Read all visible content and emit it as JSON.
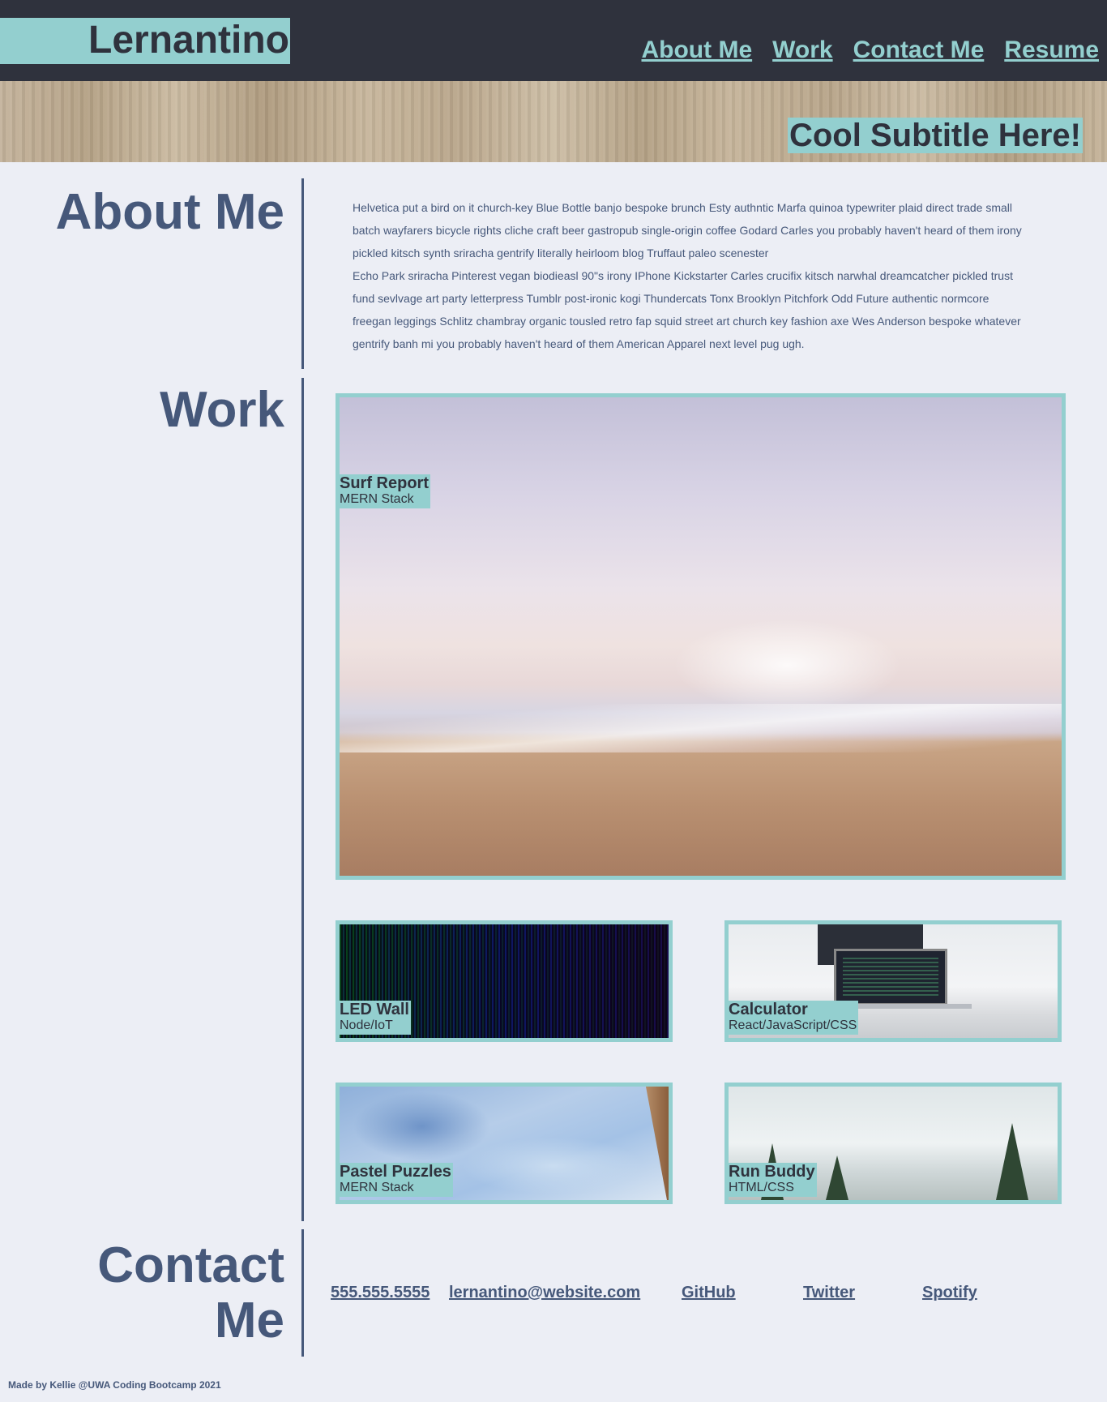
{
  "header": {
    "brand": "Lernantino",
    "nav": [
      "About Me",
      "Work",
      "Contact Me",
      "Resume"
    ]
  },
  "hero": {
    "subtitle": "Cool Subtitle Here!"
  },
  "about": {
    "heading": "About Me",
    "paragraph1": "Helvetica put a bird on it church-key Blue Bottle banjo bespoke brunch Esty authntic Marfa quinoa typewriter plaid direct trade small batch wayfarers bicycle rights cliche craft beer gastropub single-origin coffee Godard Carles you probably haven't heard of them irony pickled kitsch synth sriracha gentrify literally heirloom blog Truffaut paleo scenester",
    "paragraph2": "Echo Park sriracha Pinterest vegan biodieasl 90\"s irony IPhone Kickstarter Carles crucifix kitsch narwhal dreamcatcher pickled trust fund sevlvage art party letterpress Tumblr post-ironic kogi Thundercats Tonx Brooklyn Pitchfork Odd Future authentic normcore freegan leggings Schlitz chambray organic tousled retro fap squid street art church key fashion axe Wes Anderson bespoke whatever gentrify banh mi you probably haven't heard of them American Apparel next level pug ugh."
  },
  "work": {
    "heading": "Work",
    "projects": [
      {
        "title": "Surf Report",
        "tech": "MERN Stack"
      },
      {
        "title": "LED Wall",
        "tech": "Node/IoT"
      },
      {
        "title": "Calculator",
        "tech": "React/JavaScript/CSS"
      },
      {
        "title": "Pastel Puzzles",
        "tech": "MERN Stack"
      },
      {
        "title": "Run Buddy",
        "tech": "HTML/CSS"
      }
    ]
  },
  "contact": {
    "heading_line1": "Contact",
    "heading_line2": "Me",
    "links": [
      "555.555.5555",
      "lernantino@website.com",
      "GitHub",
      "Twitter",
      "Spotify"
    ]
  },
  "footer": {
    "text": "Made by Kellie @UWA Coding Bootcamp 2021"
  },
  "colors": {
    "header_bg": "#2f323d",
    "accent": "#93cfcf",
    "page_bg": "#eceef5",
    "text": "#46587a"
  }
}
